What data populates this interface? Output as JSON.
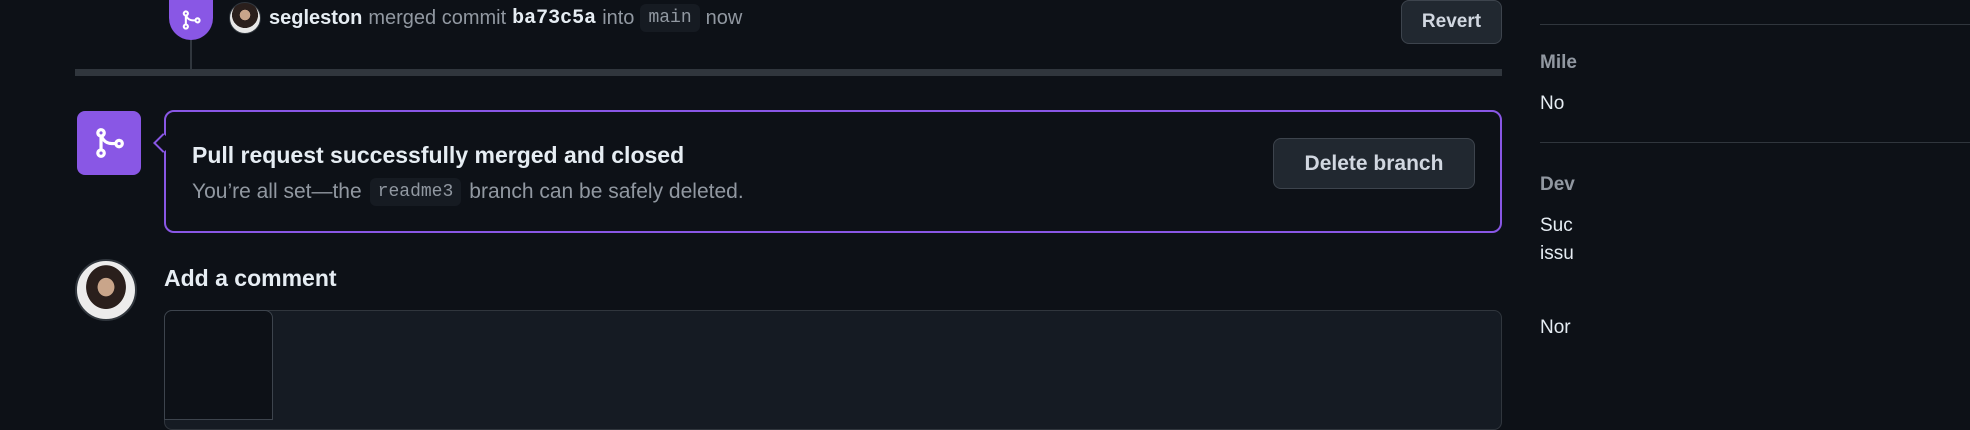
{
  "timeline_event": {
    "user": "segleston",
    "action": "merged commit",
    "sha": "ba73c5a",
    "into": "into",
    "branch": "main",
    "time": "now",
    "revert_label": "Revert"
  },
  "merged_box": {
    "title": "Pull request successfully merged and closed",
    "sub_before": "You’re all set—the",
    "branch": "readme3",
    "sub_after": "branch can be safely deleted.",
    "delete_label": "Delete branch"
  },
  "comment": {
    "heading": "Add a comment"
  },
  "sidebar": {
    "milestone_heading": "Mile",
    "milestone_value": "No",
    "development_heading": "Dev",
    "development_line1": "Suc",
    "development_line2": "issu",
    "development_value": "Nor"
  },
  "colors": {
    "merged": "#8957e5",
    "bg": "#0d1117"
  }
}
